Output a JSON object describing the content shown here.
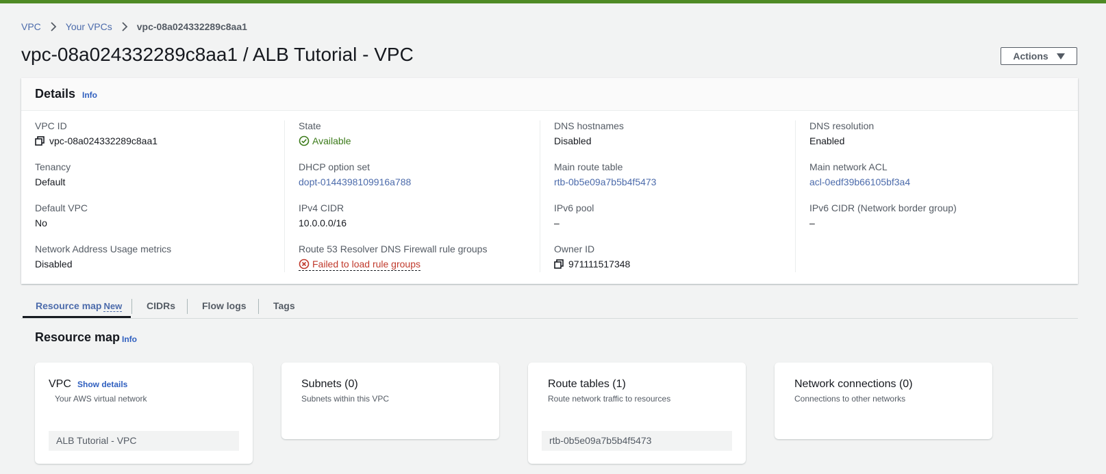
{
  "breadcrumb": {
    "items": [
      "VPC",
      "Your VPCs"
    ],
    "current": "vpc-08a024332289c8aa1"
  },
  "page": {
    "title": "vpc-08a024332289c8aa1 / ALB Tutorial - VPC",
    "actions_label": "Actions"
  },
  "details": {
    "heading": "Details",
    "info": "Info",
    "vpc_id": {
      "label": "VPC ID",
      "value": "vpc-08a024332289c8aa1"
    },
    "tenancy": {
      "label": "Tenancy",
      "value": "Default"
    },
    "default_vpc": {
      "label": "Default VPC",
      "value": "No"
    },
    "nau_metrics": {
      "label": "Network Address Usage metrics",
      "value": "Disabled"
    },
    "state": {
      "label": "State",
      "value": "Available"
    },
    "dhcp": {
      "label": "DHCP option set",
      "value": "dopt-0144398109916a788"
    },
    "ipv4": {
      "label": "IPv4 CIDR",
      "value": "10.0.0.0/16"
    },
    "route53": {
      "label": "Route 53 Resolver DNS Firewall rule groups",
      "value": "Failed to load rule groups"
    },
    "dns_hostnames": {
      "label": "DNS hostnames",
      "value": "Disabled"
    },
    "main_route_table": {
      "label": "Main route table",
      "value": "rtb-0b5e09a7b5b4f5473"
    },
    "ipv6_pool": {
      "label": "IPv6 pool",
      "value": "–"
    },
    "owner_id": {
      "label": "Owner ID",
      "value": "971111517348"
    },
    "dns_resolution": {
      "label": "DNS resolution",
      "value": "Enabled"
    },
    "main_acl": {
      "label": "Main network ACL",
      "value": "acl-0edf39b66105bf3a4"
    },
    "ipv6_cidr": {
      "label": "IPv6 CIDR (Network border group)",
      "value": "–"
    }
  },
  "tabs": [
    {
      "label": "Resource map",
      "badge": "New",
      "active": true
    },
    {
      "label": "CIDRs"
    },
    {
      "label": "Flow logs"
    },
    {
      "label": "Tags"
    }
  ],
  "resource_map": {
    "title": "Resource map",
    "info": "Info",
    "cards": [
      {
        "title": "VPC",
        "link": "Show details",
        "subtitle": "Your AWS virtual network",
        "chip": "ALB Tutorial - VPC"
      },
      {
        "title": "Subnets (0)",
        "subtitle": "Subnets within this VPC"
      },
      {
        "title": "Route tables (1)",
        "subtitle": "Route network traffic to resources",
        "chip": "rtb-0b5e09a7b5b4f5473"
      },
      {
        "title": "Network connections (0)",
        "subtitle": "Connections to other networks"
      }
    ]
  },
  "colors": {
    "accent": "#4f8a25",
    "link": "#4c6bab",
    "success": "#3b7a19",
    "error": "#c0392b"
  }
}
